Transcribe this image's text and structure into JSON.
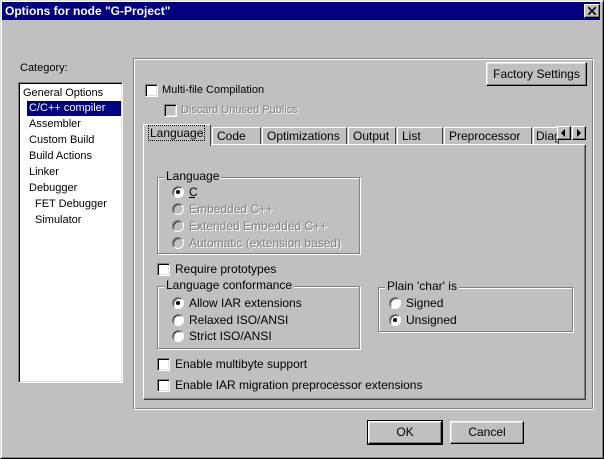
{
  "window": {
    "title": "Options for node \"G-Project\""
  },
  "category": {
    "label": "Category:",
    "items": [
      "General Options",
      "C/C++ compiler",
      "Assembler",
      "Custom Build",
      "Build Actions",
      "Linker",
      "Debugger",
      "FET Debugger",
      "Simulator"
    ],
    "selected": "C/C++ compiler"
  },
  "options": {
    "factory_settings": "Factory Settings",
    "multifile_label": "Multi-file Compilation",
    "discard_label": "Discard Unused Publics"
  },
  "tabs": [
    "Language",
    "Code",
    "Optimizations",
    "Output",
    "List",
    "Preprocessor",
    "Diag"
  ],
  "active_tab": "Language",
  "language_group": {
    "title": "Language",
    "options": [
      "C",
      "Embedded C++",
      "Extended Embedded C++",
      "Automatic (extension based)"
    ],
    "selected": "C"
  },
  "require_prototypes": "Require prototypes",
  "conformance_group": {
    "title": "Language conformance",
    "options": [
      "Allow IAR extensions",
      "Relaxed ISO/ANSI",
      "Strict ISO/ANSI"
    ],
    "selected": "Allow IAR extensions"
  },
  "char_group": {
    "title": "Plain 'char' is",
    "options": [
      "Signed",
      "Unsigned"
    ],
    "selected": "Unsigned"
  },
  "multibyte": "Enable multibyte support",
  "migration": "Enable IAR migration preprocessor extensions",
  "buttons": {
    "ok": "OK",
    "cancel": "Cancel"
  }
}
